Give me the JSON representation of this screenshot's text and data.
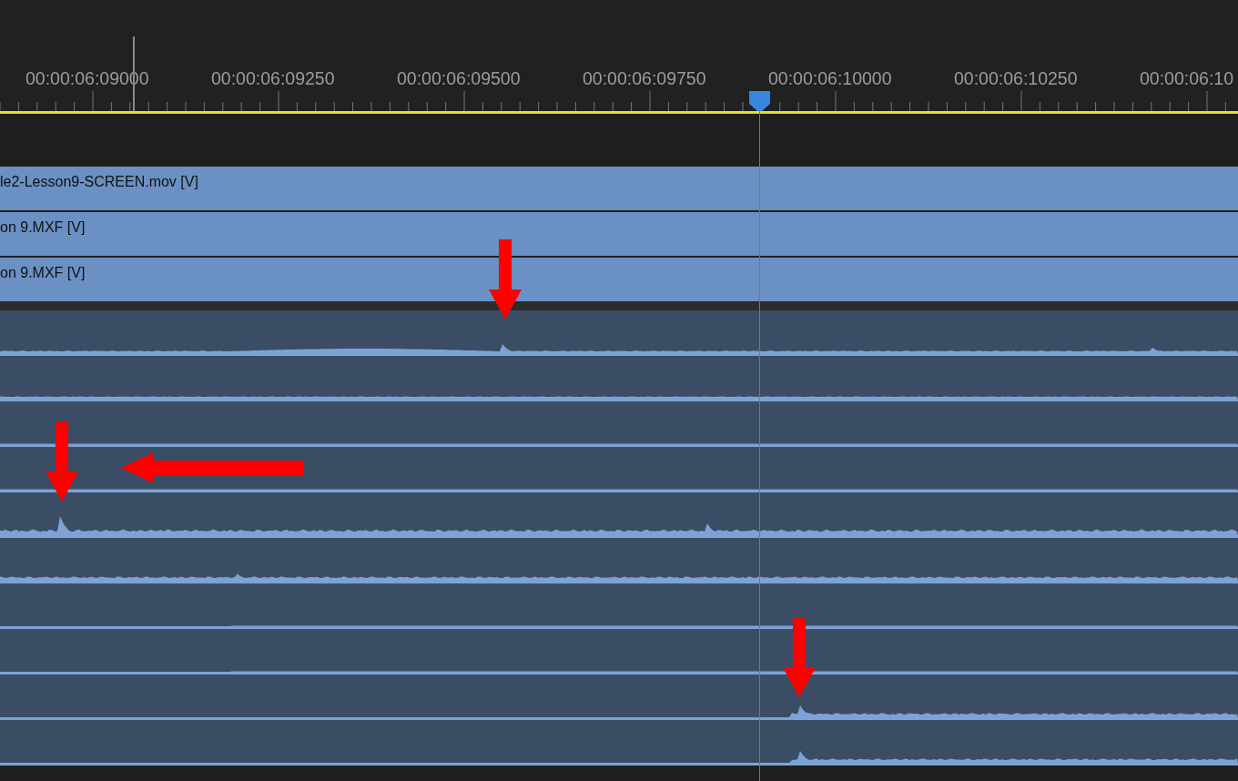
{
  "ruler": {
    "labels": [
      "00:00:06:09000",
      "00:00:06:09250",
      "00:00:06:09500",
      "00:00:06:09750",
      "00:00:06:10000",
      "00:00:06:10250",
      "00:00:06:10"
    ]
  },
  "video_clips": [
    {
      "name": "le2-Lesson9-SCREEN.mov [V]"
    },
    {
      "name": "on 9.MXF [V]"
    },
    {
      "name": "on 9.MXF [V]"
    }
  ],
  "audio_tracks": [
    {
      "kind": "waveform"
    },
    {
      "kind": "waveform"
    },
    {
      "kind": "waveform"
    },
    {
      "kind": "waveform"
    },
    {
      "kind": "waveform"
    },
    {
      "kind": "waveform"
    },
    {
      "kind": "waveform"
    },
    {
      "kind": "waveform"
    },
    {
      "kind": "waveform"
    },
    {
      "kind": "waveform"
    }
  ],
  "annotation_arrows": [
    {
      "kind": "down"
    },
    {
      "kind": "down"
    },
    {
      "kind": "left"
    },
    {
      "kind": "down"
    }
  ]
}
